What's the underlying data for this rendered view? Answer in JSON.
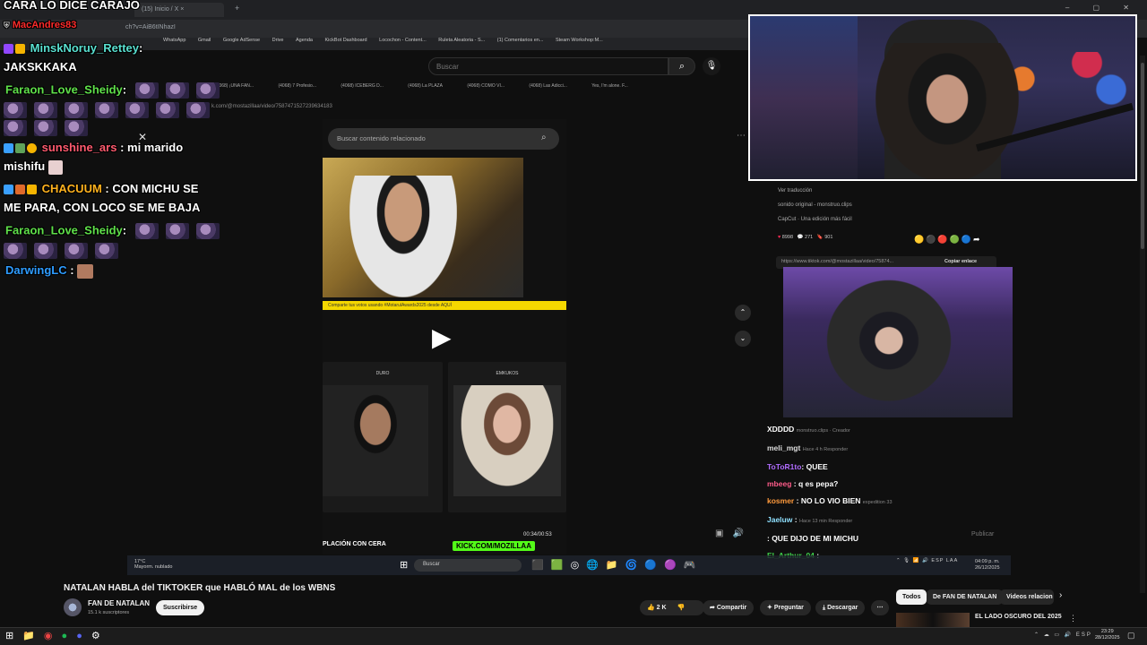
{
  "stream_title": "CARA LO DICE CARAJO",
  "browser": {
    "tabs": [
      "(15) Inicio / X"
    ],
    "url_fragment": "ch?v=AiB6tINhazI",
    "bookmarks": [
      "WhatsApp",
      "Gmail",
      "Google AdSense",
      "Drive",
      "Agenda",
      "KickBot Dashboard",
      "Locochon - Content...",
      "Ruleta Aleatoria - S...",
      "(1) Comentarios en...",
      "Steam Workshop:M..."
    ],
    "search_placeholder": "Buscar",
    "inner_tabs": [
      "(4068) ¡UNA FAN...",
      "(4068) 7 Profesio...",
      "(4068) ICEBERG D...",
      "(4068) La PLAZA",
      "(4068) COMO VI...",
      "(4068) Las Adicci...",
      "Yes, I'm alone. F..."
    ],
    "inner_url": "k.com/@mostazillaa/video/7587471527239634183"
  },
  "tiktok": {
    "search_placeholder": "Buscar contenido relacionado",
    "banner_text": "Comparte tus votos usando #MotarulAwards2025 desde AQUÍ",
    "card_labels": [
      "DURO",
      "EMKUKOS"
    ],
    "timecode": "00:34/00:53",
    "caption": "PLACIÓN CON CERA",
    "kick_tag": "KICK.COM/MOZILLAA",
    "details": [
      "Ver traducción",
      "sonido original - monstruo.clips",
      "CapCut · Una edición más fácil"
    ],
    "stats": [
      "8998",
      "271",
      "901"
    ],
    "link": "https://www.tiktok.com/@mostazillaa/video/75874...",
    "copy_link": "Copiar enlace",
    "publish": "Publicar"
  },
  "overlay_comments": [
    {
      "user": "XDDDD",
      "text": "",
      "color": "#ffffff"
    },
    {
      "user": "meli_mgt",
      "text": "",
      "color": "#ffffff"
    },
    {
      "user": "ToToR1to",
      "text": ": QUEE",
      "color": "#b06cff"
    },
    {
      "user": "mbeeg",
      "text": ": q es pepa?",
      "color": "#ff5c8a"
    },
    {
      "user": "kosmer",
      "text": ": NO LO VIO BIEN",
      "color": "#ff9a3c"
    },
    {
      "user": "Jaeluw",
      "text": ":",
      "color": "#8fe0ff"
    },
    {
      "user": "",
      "text": ": QUE DIJO DE MI MICHU",
      "color": "#ff4040"
    },
    {
      "user": "El_Arthur_04",
      "text": ":",
      "color": "#3fd14b"
    }
  ],
  "tiktok_sub": {
    "sub1": "monstruo.clips · Creador",
    "sub2": "Hace 4 h  Responder",
    "sub3": "Hace 13 min  Responder",
    "expedition": "expedition 33"
  },
  "chat": [
    {
      "user": "MacAndres83",
      "text": "",
      "color": "#ff2b2b"
    },
    {
      "user": "MinskNoruy_Rettey",
      "text": ":",
      "color": "#59e0d0"
    },
    {
      "user": "",
      "text": "JAKSKKAKA",
      "color": "#ffffff"
    },
    {
      "user": "Faraon_Love_Sheidy",
      "text": ":",
      "color": "#5fe04a"
    },
    {
      "user": "sunshine_ars",
      "text": ": mi marido",
      "color": "#ff5a6e"
    },
    {
      "user": "",
      "text": "mishifu",
      "color": "#ffffff"
    },
    {
      "user": "CHACUUM",
      "text": ": CON MICHU SE",
      "color": "#ffb21e"
    },
    {
      "user": "",
      "text": "ME PARA, CON LOCO SE ME BAJA",
      "color": "#ffffff"
    },
    {
      "user": "Faraon_Love_Sheidy",
      "text": ":",
      "color": "#5fe04a"
    },
    {
      "user": "DarwingLC",
      "text": ":",
      "color": "#2e9cff"
    }
  ],
  "inner_taskbar": {
    "weather_temp": "17°C",
    "weather_text": "Mayorm. nublado",
    "search": "Buscar",
    "lang": "ESP LAA",
    "time": "04:09 p. m.",
    "date": "26/12/2025"
  },
  "youtube": {
    "video_title": "NATALAN HABLA del TIKTOKER que HABLÓ MAL de los WBNS",
    "channel": "FAN DE NATALAN",
    "subscribers": "15.1 k suscriptores",
    "subscribe": "Suscribirse",
    "likes": "2 K",
    "share": "Compartir",
    "ask": "Preguntar",
    "download": "Descargar",
    "chips": [
      "Todos",
      "De FAN DE NATALAN",
      "Videos relacion"
    ],
    "rec_title": "EL LADO OSCURO DEL 2025"
  },
  "taskbar": {
    "lang": "ESP",
    "time": "23:29",
    "date": "28/12/2025"
  }
}
